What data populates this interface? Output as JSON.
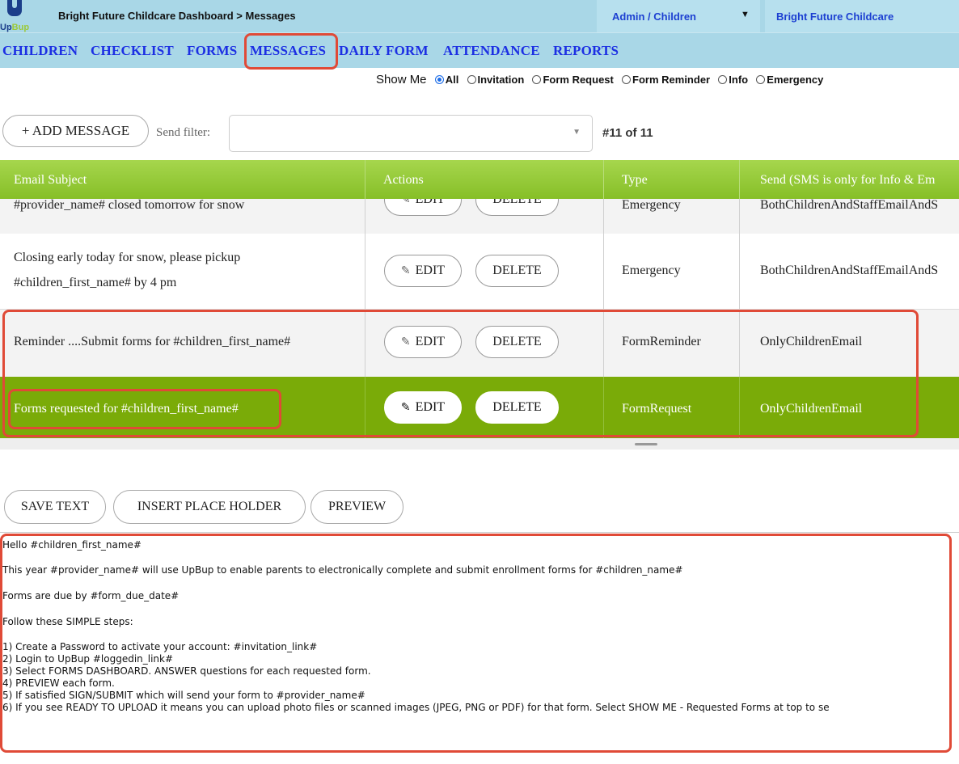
{
  "header": {
    "logo_text": "UpBup",
    "breadcrumb": "Bright Future Childcare Dashboard > Messages",
    "role_select": "Admin / Children",
    "provider_select": "Bright Future Childcare"
  },
  "nav": {
    "items": [
      "CHILDREN",
      "CHECKLIST",
      "FORMS",
      "MESSAGES",
      "DAILY FORM",
      "ATTENDANCE",
      "REPORTS"
    ],
    "active": "MESSAGES"
  },
  "filter_bar": {
    "label": "Show Me",
    "options": [
      "All",
      "Invitation",
      "Form Request",
      "Form Reminder",
      "Info",
      "Emergency"
    ],
    "selected": "All"
  },
  "toolbar": {
    "add_button": "+ ADD MESSAGE",
    "send_filter_label": "Send filter:",
    "send_filter_value": "",
    "count": "#11 of 11"
  },
  "table": {
    "columns": [
      "Email Subject",
      "Actions",
      "Type",
      "Send (SMS is only for Info & Em"
    ],
    "edit_label": "EDIT",
    "delete_label": "DELETE",
    "rows": [
      {
        "subject": "#provider_name# closed tomorrow for snow",
        "type": "Emergency",
        "send": "BothChildrenAndStaffEmailAndS"
      },
      {
        "subject_line1": "Closing early today for snow, please pickup",
        "subject_line2": "#children_first_name# by 4 pm",
        "type": "Emergency",
        "send": "BothChildrenAndStaffEmailAndS"
      },
      {
        "subject": "Reminder ....Submit forms for #children_first_name#",
        "type": "FormReminder",
        "send": "OnlyChildrenEmail"
      },
      {
        "subject": "Forms requested for #children_first_name#",
        "type": "FormRequest",
        "send": "OnlyChildrenEmail",
        "selected": true
      }
    ]
  },
  "editor_toolbar": {
    "save": "SAVE TEXT",
    "insert": "INSERT PLACE HOLDER",
    "preview": "PREVIEW"
  },
  "editor": {
    "lines": [
      "Hello #children_first_name#",
      "This year #provider_name# will use UpBup to enable parents to electronically complete and submit enrollment forms for #children_name#",
      "Forms are due by #form_due_date#",
      "Follow these SIMPLE steps:",
      "1) Create a Password to activate your account: #invitation_link#",
      "2) Login to UpBup #loggedin_link#",
      "3) Select FORMS DASHBOARD. ANSWER questions for each requested form.",
      "4) PREVIEW each form.",
      "5) If satisfied SIGN/SUBMIT which will send your form to #provider_name#",
      "6) If you see READY TO UPLOAD it means you can upload photo files or scanned images (JPEG, PNG or PDF) for that form. Select SHOW ME - Requested Forms at top to se"
    ]
  },
  "colors": {
    "header_bg": "#a9d7e7",
    "nav_link": "#1c2fe3",
    "table_header_green": "#8cc43a",
    "selected_row_green": "#7aab08",
    "highlight_red": "#e04a37"
  }
}
